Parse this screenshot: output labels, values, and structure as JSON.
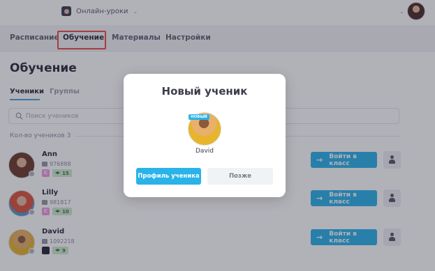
{
  "app": {
    "section_name": "Онлайн-уроки"
  },
  "nav": {
    "items": [
      {
        "label": "Расписание"
      },
      {
        "label": "Обучение"
      },
      {
        "label": "Материалы"
      },
      {
        "label": "Настройки"
      }
    ],
    "active": "Обучение"
  },
  "page": {
    "title": "Обучение",
    "tabs": [
      {
        "label": "Ученики"
      },
      {
        "label": "Группы"
      }
    ],
    "search_placeholder": "Поиск учеников",
    "count_label": "Кол-во учеников 3"
  },
  "students": [
    {
      "name": "Ann",
      "id": "976888",
      "course_badge": "C",
      "score": "15",
      "join_label": "Войти в класс"
    },
    {
      "name": "Lilly",
      "id": "981817",
      "course_badge": "C",
      "score": "10",
      "join_label": "Войти в класс"
    },
    {
      "name": "David",
      "id": "1092218",
      "course_badge": "",
      "score": "9",
      "join_label": "Войти в класс"
    }
  ],
  "modal": {
    "title": "Новый ученик",
    "badge": "НОВЫЙ",
    "student_name": "David",
    "primary_label": "Профиль ученика",
    "secondary_label": "Позже"
  },
  "colors": {
    "accent": "#29b3e9",
    "highlight": "#f04848",
    "badge_pink": "#ef9ae0",
    "score_bg": "#cfe9cf"
  }
}
